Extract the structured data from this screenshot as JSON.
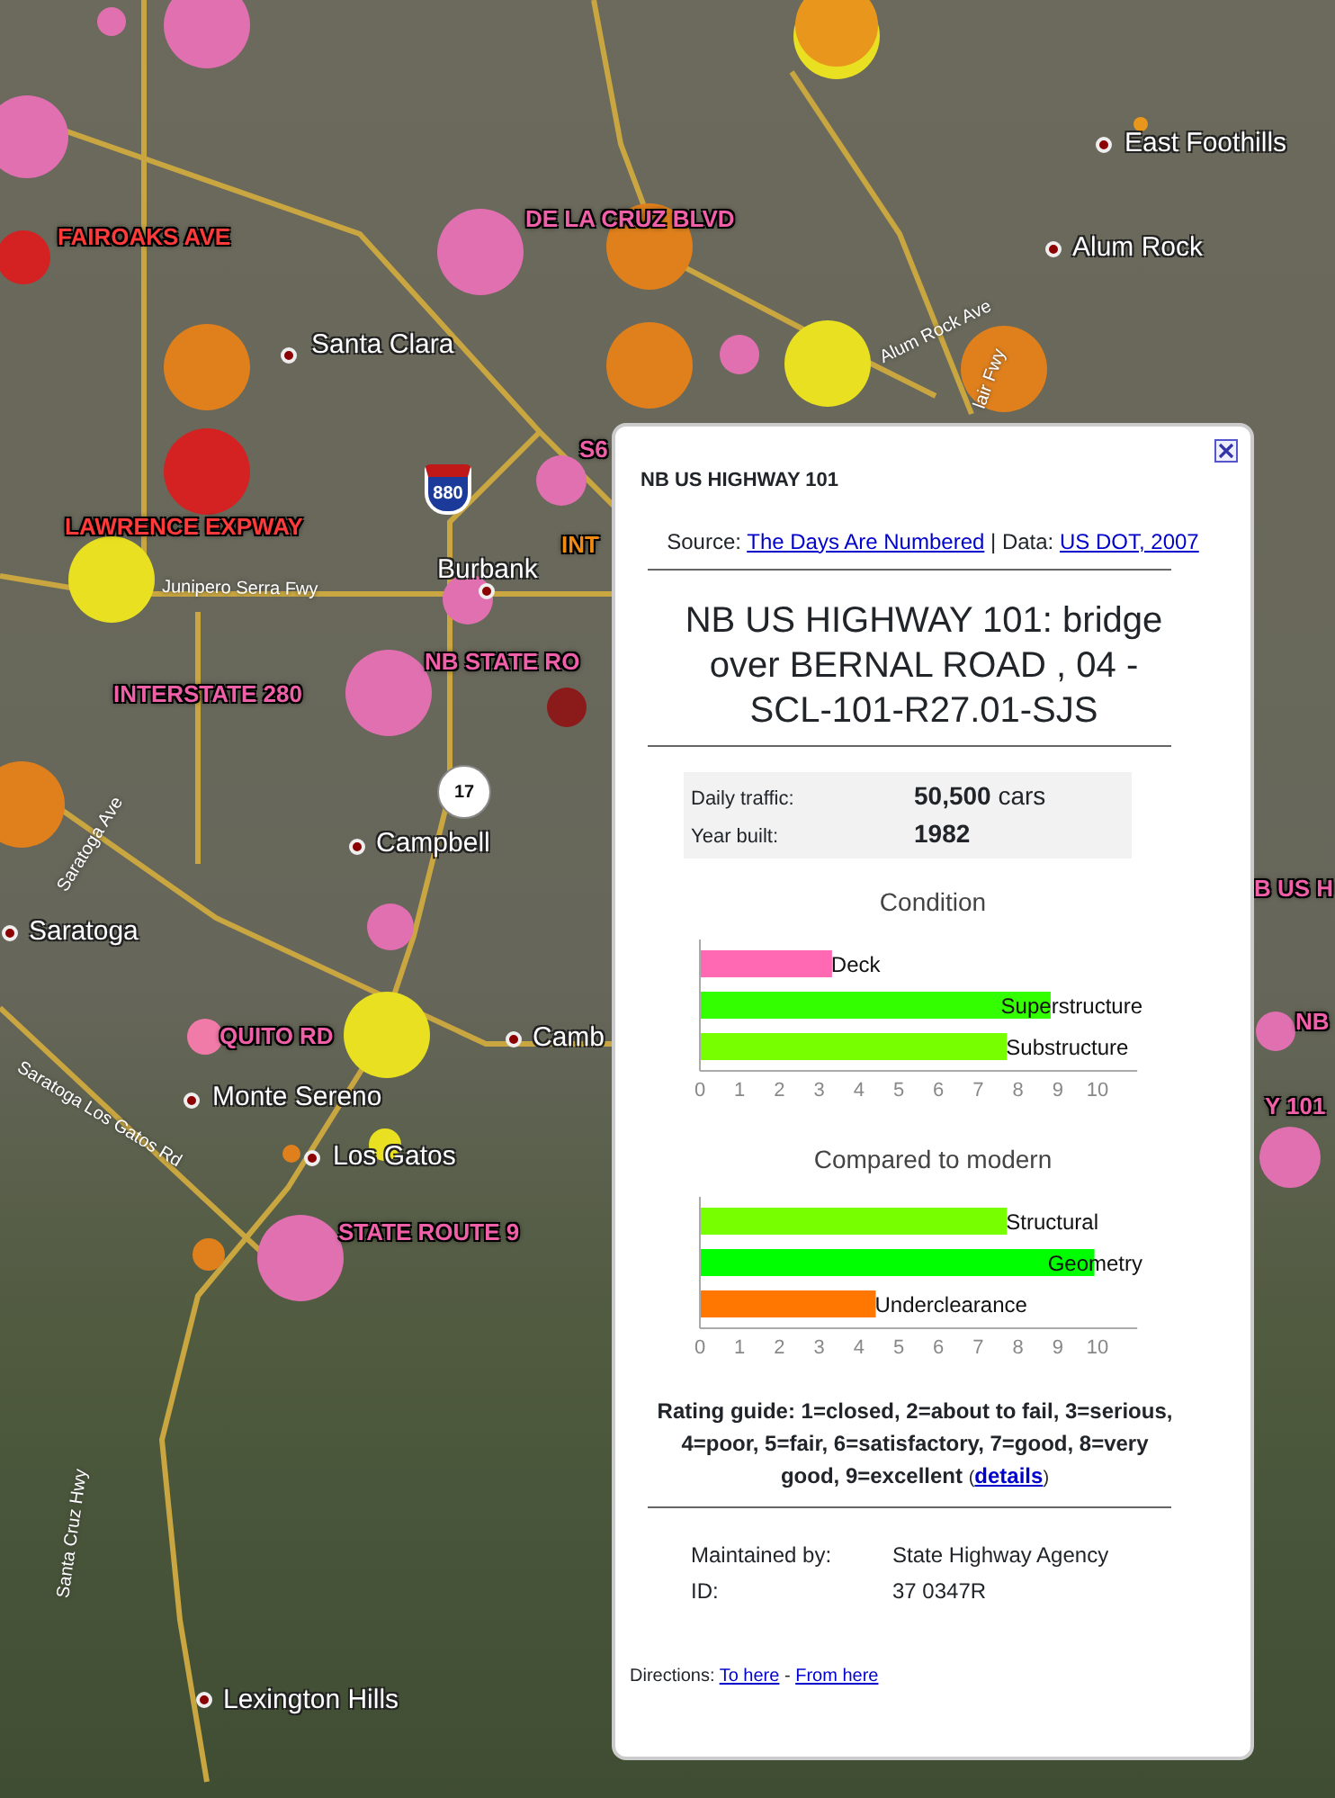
{
  "map": {
    "markers": [
      {
        "color": "#e070b0"
      },
      {
        "color": "#e070b0"
      },
      {
        "color": "#e8e020"
      },
      {
        "color": "#e8961c"
      },
      {
        "color": "#e070b0"
      },
      {
        "color": "#d42222"
      },
      {
        "color": "#e070b0"
      },
      {
        "color": "#e0801c"
      },
      {
        "color": "#e0801c"
      },
      {
        "color": "#e0801c"
      },
      {
        "color": "#e070b0"
      },
      {
        "color": "#e8e020"
      },
      {
        "color": "#e0801c"
      },
      {
        "color": "#d42222"
      },
      {
        "color": "#e070b0"
      },
      {
        "color": "#e8e020"
      },
      {
        "color": "#e070b0"
      },
      {
        "color": "#e070b0"
      },
      {
        "color": "#8b1a1a"
      },
      {
        "color": "#e0801c"
      },
      {
        "color": "#e070b0"
      },
      {
        "color": "#e8e020"
      },
      {
        "color": "#f07aa8"
      },
      {
        "color": "#e070b0"
      },
      {
        "color": "#e0801c"
      },
      {
        "color": "#e0801c"
      },
      {
        "color": "#e8e020"
      },
      {
        "color": "#e070b0"
      },
      {
        "color": "#e070b0"
      },
      {
        "color": "#e8961c"
      }
    ],
    "road_labels": [
      {
        "text": "FAIROAKS AVE",
        "color": "#ff3a3a"
      },
      {
        "text": "DE LA CRUZ BLVD",
        "color": "#f060a8"
      },
      {
        "text": "S6",
        "color": "#f060a8"
      },
      {
        "text": "LAWRENCE EXPWAY",
        "color": "#ff3a3a"
      },
      {
        "text": "INT",
        "color": "#f08a10"
      },
      {
        "text": "NB STATE RO",
        "color": "#f060a8"
      },
      {
        "text": "INTERSTATE 280",
        "color": "#f060a8"
      },
      {
        "text": "QUITO RD",
        "color": "#f060a8"
      },
      {
        "text": "STATE ROUTE 9",
        "color": "#f060a8"
      },
      {
        "text": "B US H",
        "color": "#f060a8"
      },
      {
        "text": "NB",
        "color": "#f060a8"
      },
      {
        "text": "Y 101",
        "color": "#f060a8"
      }
    ],
    "places": [
      {
        "name": "East Foothills"
      },
      {
        "name": "Alum Rock"
      },
      {
        "name": "Santa Clara"
      },
      {
        "name": "Burbank"
      },
      {
        "name": "Campbell"
      },
      {
        "name": "Saratoga"
      },
      {
        "name": "Camb"
      },
      {
        "name": "Monte Sereno"
      },
      {
        "name": "Los Gatos"
      },
      {
        "name": "Lexington Hills"
      }
    ],
    "road_names": [
      {
        "text": "Alum Rock Ave"
      },
      {
        "text": "lair Fwy"
      },
      {
        "text": "Junipero Serra Fwy"
      },
      {
        "text": "Saratoga Ave"
      },
      {
        "text": "Saratoga Los Gatos Rd"
      },
      {
        "text": "Santa Cruz Hwy"
      }
    ],
    "shields": [
      {
        "text": "880",
        "kind": "interstate"
      },
      {
        "text": "17",
        "kind": "state"
      }
    ]
  },
  "popup": {
    "title": "NB US HIGHWAY 101",
    "source": [
      {
        "kind": "text",
        "text": "Source: "
      },
      {
        "kind": "link",
        "text": "The Days Are Numbered"
      },
      {
        "kind": "text",
        "text": " | Data: "
      },
      {
        "kind": "link",
        "text": "US DOT, 2007"
      }
    ],
    "heading": "NB US HIGHWAY 101: bridge over BERNAL ROAD , 04 -SCL-101-R27.01-SJS",
    "facts": [
      {
        "label": "Daily traffic:",
        "value": "**50,500** cars"
      },
      {
        "label": "Year built:",
        "value": "**1982**"
      }
    ],
    "charts": [
      {
        "chart_data": {
          "type": "bar",
          "orientation": "horizontal",
          "title": "Condition",
          "xlim": [
            0,
            11
          ],
          "xticks": [
            0,
            1,
            2,
            3,
            4,
            5,
            6,
            7,
            8,
            9,
            10
          ],
          "series": [
            {
              "name": "Deck",
              "color": "#ff69b4",
              "values": [
                3.3,
                null,
                null
              ]
            },
            {
              "name": "Superstructure",
              "color": "#33ff00",
              "values": [
                null,
                8.8,
                null
              ]
            },
            {
              "name": "Substructure",
              "color": "#77ff00",
              "values": [
                null,
                null,
                7.7
              ]
            }
          ]
        }
      },
      {
        "chart_data": {
          "type": "bar",
          "orientation": "horizontal",
          "title": "Compared to modern",
          "xlim": [
            0,
            11
          ],
          "xticks": [
            0,
            1,
            2,
            3,
            4,
            5,
            6,
            7,
            8,
            9,
            10
          ],
          "series": [
            {
              "name": "Structural",
              "color": "#77ff00",
              "values": [
                7.7,
                null,
                null
              ]
            },
            {
              "name": "Geometry",
              "color": "#00ff00",
              "values": [
                null,
                9.9,
                null
              ]
            },
            {
              "name": "Underclearance",
              "color": "#ff7700",
              "values": [
                null,
                null,
                4.4
              ]
            }
          ]
        }
      }
    ],
    "rating_guide": [
      {
        "kind": "text",
        "text": "Rating guide: 1=closed, 2=about to fail, 3=serious, 4=poor, 5=fair, 6=satisfactory, 7=good, 8=very good, 9=excellent "
      },
      {
        "kind": "small",
        "text": "("
      },
      {
        "kind": "link",
        "text": "details"
      },
      {
        "kind": "small",
        "text": ")"
      }
    ],
    "details": [
      {
        "label": "Maintained by:",
        "value": "State Highway Agency"
      },
      {
        "label": "ID:",
        "value": "37 0347R"
      }
    ],
    "directions": [
      {
        "kind": "text",
        "text": "Directions: "
      },
      {
        "kind": "link",
        "text": "To here"
      },
      {
        "kind": "text",
        "text": " - "
      },
      {
        "kind": "link",
        "text": "From here"
      }
    ]
  }
}
